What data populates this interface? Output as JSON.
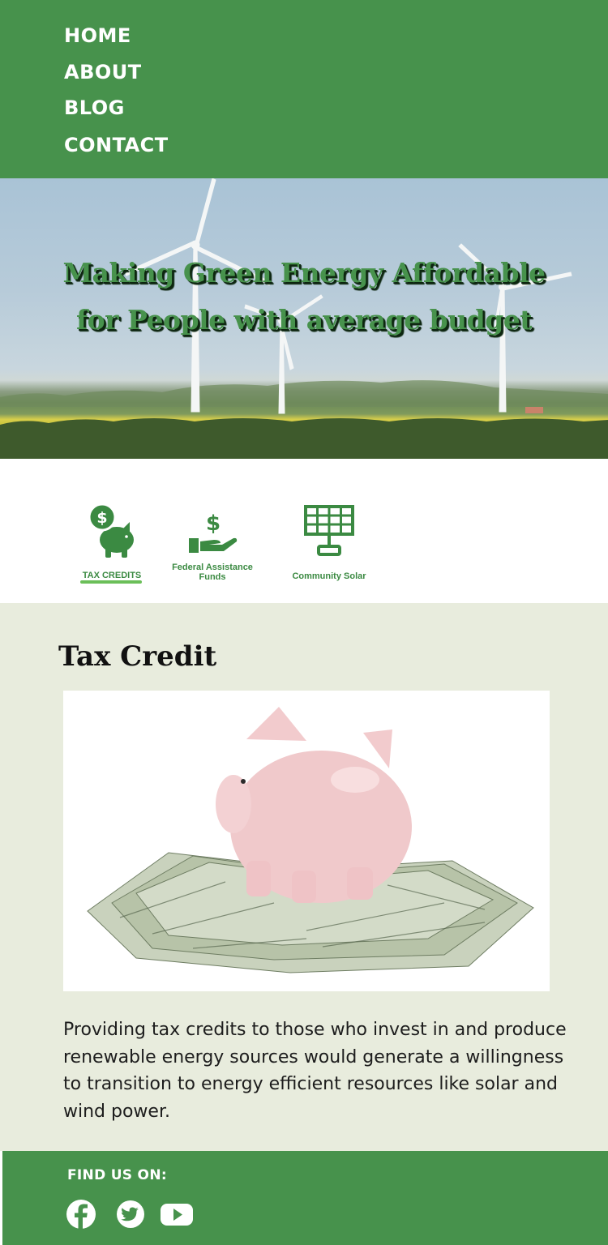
{
  "nav": {
    "items": [
      {
        "label": "HOME"
      },
      {
        "label": "ABOUT"
      },
      {
        "label": "BLOG"
      },
      {
        "label": "CONTACT"
      }
    ]
  },
  "hero": {
    "title_line1": "Making Green Energy Affordable",
    "title_line2": "for People with average budget"
  },
  "tabs": [
    {
      "label": "TAX CREDITS",
      "icon": "piggy-bank-dollar-icon",
      "active": true
    },
    {
      "label_line1": "Federal Assistance",
      "label_line2": "Funds",
      "icon": "hand-dollar-icon",
      "active": false
    },
    {
      "label": "Community Solar",
      "icon": "solar-panel-icon",
      "active": false
    }
  ],
  "content": {
    "title": "Tax Credit",
    "image": "piggy-bank-on-dollar-bills",
    "body": "Providing tax credits to those who invest in and produce renewable energy sources would generate a willingness to transition to energy efficient resources like solar and wind power."
  },
  "footer": {
    "label": "FIND US ON:",
    "social": [
      {
        "icon": "facebook-icon"
      },
      {
        "icon": "twitter-icon"
      },
      {
        "icon": "youtube-icon"
      }
    ]
  },
  "colors": {
    "brand_green": "#47924c",
    "accent_underline": "#6bbf59",
    "content_bg": "#e8ecdd"
  }
}
